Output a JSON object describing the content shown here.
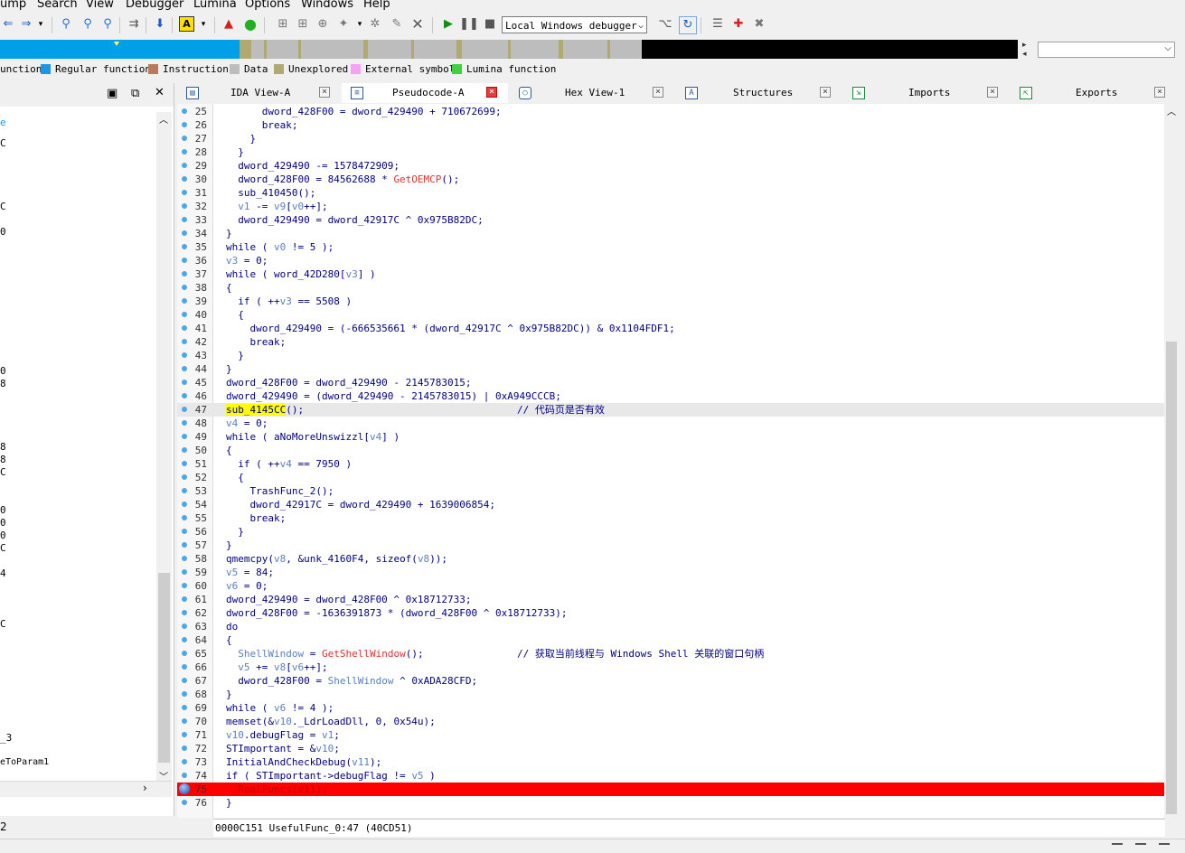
{
  "menu": [
    "ump",
    "Search",
    "View",
    "Debugger",
    "Lumina",
    "Options",
    "Windows",
    "Help"
  ],
  "toolbar": {
    "debugger_select": "Local Windows debugger"
  },
  "legend": [
    {
      "label": "unction",
      "color": ""
    },
    {
      "label": "Regular function",
      "color": "#1e96e6"
    },
    {
      "label": "Instruction",
      "color": "#b87a5a"
    },
    {
      "label": "Data",
      "color": "#bdbdbd"
    },
    {
      "label": "Unexplored",
      "color": "#b0aa70"
    },
    {
      "label": "External symbol",
      "color": "#f7a0f7"
    },
    {
      "label": "Lumina function",
      "color": "#40d040"
    }
  ],
  "left_panel": {
    "fragments": [
      "e",
      "C",
      "C",
      "0",
      "0",
      "8",
      "8",
      "8",
      "C",
      "0",
      "0",
      "0",
      "C",
      "4",
      "C",
      "_3",
      "eToParam1"
    ],
    "status": "2"
  },
  "tabs": [
    {
      "label": "IDA View-A",
      "icon": "ida-view-icon",
      "active": false
    },
    {
      "label": "Pseudocode-A",
      "icon": "pseudocode-icon",
      "active": true
    },
    {
      "label": "Hex View-1",
      "icon": "hex-view-icon",
      "active": false
    },
    {
      "label": "Structures",
      "icon": "structures-icon",
      "active": false
    },
    {
      "label": "Imports",
      "icon": "imports-icon",
      "active": false
    },
    {
      "label": "Exports",
      "icon": "exports-icon",
      "active": false
    }
  ],
  "code_lines": [
    {
      "n": "25",
      "code": "      dword_428F00 = dword_429490 + 710672699;"
    },
    {
      "n": "26",
      "code": "      break;"
    },
    {
      "n": "27",
      "code": "    }"
    },
    {
      "n": "28",
      "code": "  }"
    },
    {
      "n": "29",
      "code": "  dword_429490 -= 1578472909;"
    },
    {
      "n": "30",
      "code": "  dword_428F00 = 84562688 * GetOEMCP();"
    },
    {
      "n": "31",
      "code": "  sub_410450();"
    },
    {
      "n": "32",
      "code": "  v1 -= v9[v0++];"
    },
    {
      "n": "33",
      "code": "  dword_429490 = dword_42917C ^ 0x975B82DC;"
    },
    {
      "n": "34",
      "code": "}"
    },
    {
      "n": "35",
      "code": "while ( v0 != 5 );"
    },
    {
      "n": "36",
      "code": "v3 = 0;"
    },
    {
      "n": "37",
      "code": "while ( word_42D280[v3] )"
    },
    {
      "n": "38",
      "code": "{"
    },
    {
      "n": "39",
      "code": "  if ( ++v3 == 5508 )"
    },
    {
      "n": "40",
      "code": "  {"
    },
    {
      "n": "41",
      "code": "    dword_429490 = (-666535661 * (dword_42917C ^ 0x975B82DC)) & 0x1104FDF1;"
    },
    {
      "n": "42",
      "code": "    break;"
    },
    {
      "n": "43",
      "code": "  }"
    },
    {
      "n": "44",
      "code": "}"
    },
    {
      "n": "45",
      "code": "dword_428F00 = dword_429490 - 2145783015;"
    },
    {
      "n": "46",
      "code": "dword_429490 = (dword_429490 - 2145783015) | 0xA949CCCB;"
    },
    {
      "n": "47",
      "code": "sub_4145CC();",
      "comment": "// 代码页是否有效"
    },
    {
      "n": "48",
      "code": "v4 = 0;"
    },
    {
      "n": "49",
      "code": "while ( aNoMoreUnswizzl[v4] )"
    },
    {
      "n": "50",
      "code": "{"
    },
    {
      "n": "51",
      "code": "  if ( ++v4 == 7950 )"
    },
    {
      "n": "52",
      "code": "  {"
    },
    {
      "n": "53",
      "code": "    TrashFunc_2();"
    },
    {
      "n": "54",
      "code": "    dword_42917C = dword_429490 + 1639006854;"
    },
    {
      "n": "55",
      "code": "    break;"
    },
    {
      "n": "56",
      "code": "  }"
    },
    {
      "n": "57",
      "code": "}"
    },
    {
      "n": "58",
      "code": "qmemcpy(v8, &unk_4160F4, sizeof(v8));"
    },
    {
      "n": "59",
      "code": "v5 = 84;"
    },
    {
      "n": "60",
      "code": "v6 = 0;"
    },
    {
      "n": "61",
      "code": "dword_429490 = dword_428F00 ^ 0x18712733;"
    },
    {
      "n": "62",
      "code": "dword_428F00 = -1636391873 * (dword_428F00 ^ 0x18712733);"
    },
    {
      "n": "63",
      "code": "do"
    },
    {
      "n": "64",
      "code": "{"
    },
    {
      "n": "65",
      "code": "  ShellWindow = GetShellWindow();",
      "comment": "// 获取当前线程与 Windows Shell 关联的窗口句柄"
    },
    {
      "n": "66",
      "code": "  v5 += v8[v6++];"
    },
    {
      "n": "67",
      "code": "  dword_428F00 = ShellWindow ^ 0xADA28CFD;"
    },
    {
      "n": "68",
      "code": "}"
    },
    {
      "n": "69",
      "code": "while ( v6 != 4 );"
    },
    {
      "n": "70",
      "code": "memset(&v10._LdrLoadDll, 0, 0x54u);"
    },
    {
      "n": "71",
      "code": "v10.debugFlag = v1;"
    },
    {
      "n": "72",
      "code": "STImportant = &v10;"
    },
    {
      "n": "73",
      "code": "InitialAndCheckDebug(v11);"
    },
    {
      "n": "74",
      "code": "if ( STImportant->debugFlag != v5 )"
    },
    {
      "n": "75",
      "code": "  RealFuncs(v11);",
      "breakpoint": true
    },
    {
      "n": "76",
      "code": "}"
    }
  ],
  "code_status": "0000C151 UsefulFunc_0:47 (40CD51)",
  "colors": {
    "accent": "#1e96e6",
    "breakpoint": "#ff0000"
  }
}
